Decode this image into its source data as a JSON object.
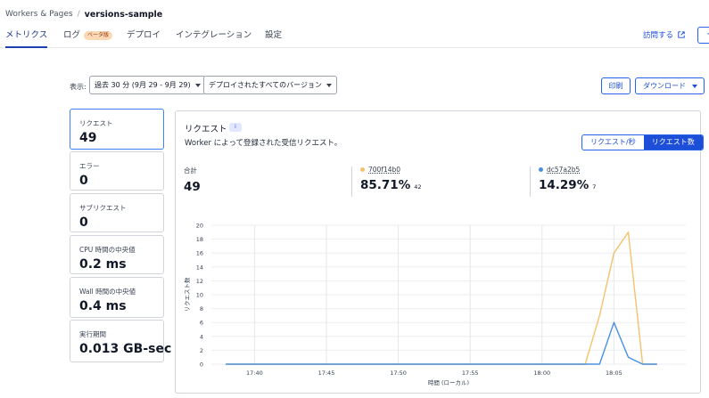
{
  "breadcrumb": {
    "parent": "Workers & Pages",
    "separator": "/",
    "current": "versions-sample"
  },
  "tabs": [
    {
      "label": "メトリクス",
      "active": true
    },
    {
      "label": "ログ",
      "badge": "ベータ版"
    },
    {
      "label": "デプロイ"
    },
    {
      "label": "インテグレーション"
    },
    {
      "label": "設定"
    }
  ],
  "header_actions": {
    "visit_label": "訪問する",
    "visit_icon": "external-link-icon",
    "edge_button": "+"
  },
  "filters": {
    "label": "表示:",
    "time_range": "過去 30 分 (9月 29 - 9月 29)",
    "versions": "デプロイされたすべてのバージョン",
    "print_label": "印刷",
    "download_label": "ダウンロード"
  },
  "metrics": [
    {
      "label": "リクエスト",
      "value": "49",
      "selected": true
    },
    {
      "label": "エラー",
      "value": "0"
    },
    {
      "label": "サブリクエスト",
      "value": "0"
    },
    {
      "label": "CPU 時間の中央値",
      "value": "0.2 ms"
    },
    {
      "label": "Wall 時間の中央値",
      "value": "0.4 ms"
    },
    {
      "label": "実行期間",
      "value": "0.013 GB-sec"
    }
  ],
  "panel": {
    "title": "リクエスト",
    "info_icon": "info-icon",
    "subtitle": "Worker によって登録された受信リクエスト。",
    "toggle": {
      "per_second": "リクエスト/秒",
      "count": "リクエスト数",
      "active": "count"
    },
    "stats": {
      "total_label": "合計",
      "total_value": "49",
      "versions": [
        {
          "id": "700f14b0",
          "percent": "85.71%",
          "count": "42",
          "color": "#f5c26b"
        },
        {
          "id": "dc57a2b5",
          "percent": "14.29%",
          "count": "7",
          "color": "#4a90e2"
        }
      ]
    }
  },
  "chart_data": {
    "type": "line",
    "xlabel": "時間 (ローカル)",
    "ylabel": "リクエスト数",
    "ylim": [
      0,
      20
    ],
    "yticks": [
      0,
      2,
      4,
      6,
      8,
      10,
      12,
      14,
      16,
      18,
      20
    ],
    "xticks": [
      "17:40",
      "17:45",
      "17:50",
      "17:55",
      "18:00",
      "18:05"
    ],
    "grid": true,
    "x": [
      "17:38",
      "18:03",
      "18:04",
      "18:05",
      "18:06",
      "18:07",
      "18:08"
    ],
    "series": [
      {
        "name": "700f14b0",
        "color": "#f5c26b",
        "values": [
          0,
          0,
          7,
          16,
          19,
          0,
          0
        ]
      },
      {
        "name": "dc57a2b5",
        "color": "#4a90e2",
        "values": [
          0,
          0,
          0,
          6,
          1,
          0,
          0
        ]
      }
    ]
  }
}
